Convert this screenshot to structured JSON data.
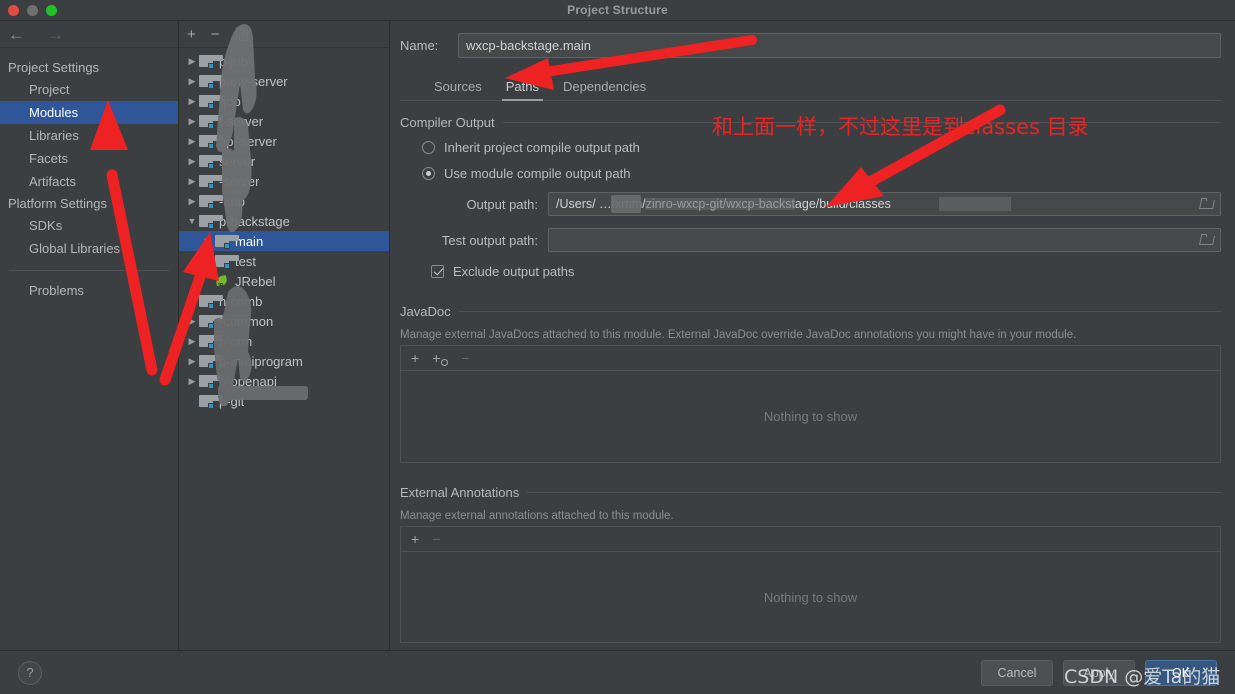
{
  "window": {
    "title": "Project Structure",
    "traffic_lights": [
      "close",
      "minimize",
      "zoom"
    ]
  },
  "nav": {
    "back_icon": "arrow-left-icon",
    "forward_icon": "arrow-right-icon"
  },
  "sidebar": {
    "groups": [
      {
        "label": "Project Settings",
        "items": [
          {
            "label": "Project",
            "selected": false
          },
          {
            "label": "Modules",
            "selected": true
          },
          {
            "label": "Libraries",
            "selected": false
          },
          {
            "label": "Facets",
            "selected": false
          },
          {
            "label": "Artifacts",
            "selected": false
          }
        ]
      },
      {
        "label": "Platform Settings",
        "items": [
          {
            "label": "SDKs",
            "selected": false
          },
          {
            "label": "Global Libraries",
            "selected": false
          }
        ]
      }
    ],
    "problems_label": "Problems"
  },
  "tree": {
    "toolbar": [
      {
        "name": "add-module-button",
        "glyph": "+"
      },
      {
        "name": "remove-module-button",
        "glyph": "−"
      },
      {
        "name": "copy-module-button",
        "glyph": "❐"
      }
    ],
    "rows": [
      {
        "label": "p-job",
        "level": 1,
        "twisty": "collapsed",
        "icon": "module-folder-icon",
        "selected": false
      },
      {
        "label": "pany-server",
        "level": 1,
        "twisty": "collapsed",
        "icon": "module-folder-icon",
        "selected": false
      },
      {
        "label": "-job",
        "level": 1,
        "twisty": "collapsed",
        "icon": "module-folder-icon",
        "selected": false
      },
      {
        "label": "t-server",
        "level": 1,
        "twisty": "collapsed",
        "icon": "module-folder-icon",
        "selected": false
      },
      {
        "label": "api-server",
        "level": 1,
        "twisty": "collapsed",
        "icon": "module-folder-icon",
        "selected": false
      },
      {
        "label": "server",
        "level": 1,
        "twisty": "collapsed",
        "icon": "module-folder-icon",
        "selected": false
      },
      {
        "label": "-server",
        "level": 1,
        "twisty": "collapsed",
        "icon": "module-folder-icon",
        "selected": false
      },
      {
        "label": "-app",
        "level": 1,
        "twisty": "collapsed",
        "icon": "module-folder-icon",
        "selected": false
      },
      {
        "label": "p-backstage",
        "level": 1,
        "twisty": "expanded",
        "icon": "module-folder-icon",
        "selected": false
      },
      {
        "label": "main",
        "level": 2,
        "twisty": "collapsed",
        "icon": "module-folder-icon",
        "selected": true
      },
      {
        "label": "test",
        "level": 2,
        "twisty": "collapsed",
        "icon": "module-folder-icon",
        "selected": false
      },
      {
        "label": "JRebel",
        "level": 2,
        "twisty": "none",
        "icon": "jrebel-icon",
        "selected": false
      },
      {
        "label": "n-comb",
        "level": 1,
        "twisty": "collapsed",
        "icon": "module-folder-icon",
        "selected": false
      },
      {
        "label": "-common",
        "level": 1,
        "twisty": "collapsed",
        "icon": "module-folder-icon",
        "selected": false
      },
      {
        "label": "p-crm",
        "level": 1,
        "twisty": "collapsed",
        "icon": "module-folder-icon",
        "selected": false
      },
      {
        "label": "p-miniprogram",
        "level": 1,
        "twisty": "collapsed",
        "icon": "module-folder-icon",
        "selected": false
      },
      {
        "label": "p-openapi",
        "level": 1,
        "twisty": "collapsed",
        "icon": "module-folder-icon",
        "selected": false
      },
      {
        "label": "p-git",
        "level": 1,
        "twisty": "none",
        "icon": "module-folder-icon",
        "selected": false
      }
    ]
  },
  "module": {
    "name_label": "Name:",
    "name_value": "wxcp-backstage.main",
    "tabs": [
      {
        "label": "Sources",
        "active": false
      },
      {
        "label": "Paths",
        "active": true
      },
      {
        "label": "Dependencies",
        "active": false
      }
    ],
    "compiler_output": {
      "title": "Compiler Output",
      "inherit_label": "Inherit project compile output path",
      "inherit_selected": false,
      "use_module_label": "Use module compile output path",
      "use_module_selected": true,
      "output_path_label": "Output path:",
      "output_path_value": "/Users/                              …/xmm/zinro-wxcp-git/wxcp-backstage/build/classes",
      "test_output_path_label": "Test output path:",
      "test_output_path_value": "",
      "exclude_label": "Exclude output paths",
      "exclude_checked": true
    },
    "javadoc": {
      "title": "JavaDoc",
      "description": "Manage external JavaDocs attached to this module. External JavaDoc override JavaDoc annotations you might have in your module.",
      "toolbar": [
        {
          "name": "add-javadoc-path-button",
          "glyph": "+"
        },
        {
          "name": "add-javadoc-url-button",
          "glyph": "+globe"
        },
        {
          "name": "remove-javadoc-button",
          "glyph": "−"
        }
      ],
      "empty_text": "Nothing to show"
    },
    "external_annotations": {
      "title": "External Annotations",
      "description": "Manage external annotations attached to this module.",
      "toolbar": [
        {
          "name": "add-annotation-button",
          "glyph": "+"
        },
        {
          "name": "remove-annotation-button",
          "glyph": "−"
        }
      ],
      "empty_text": "Nothing to show"
    }
  },
  "footer": {
    "help_glyph": "?",
    "cancel_label": "Cancel",
    "apply_label": "Apply",
    "ok_label": "OK"
  },
  "annotations": {
    "note_text": "和上面一样，不过这里是到classes 目录",
    "arrow_color": "#ee2222",
    "watermark": "CSDN @爱Ta的猫"
  },
  "colors": {
    "window_bg": "#3c3f41",
    "selection_blue": "#2f5699",
    "primary_button": "#365880",
    "annotation_red": "#ee2222",
    "folder_badge": "#3592c4"
  }
}
